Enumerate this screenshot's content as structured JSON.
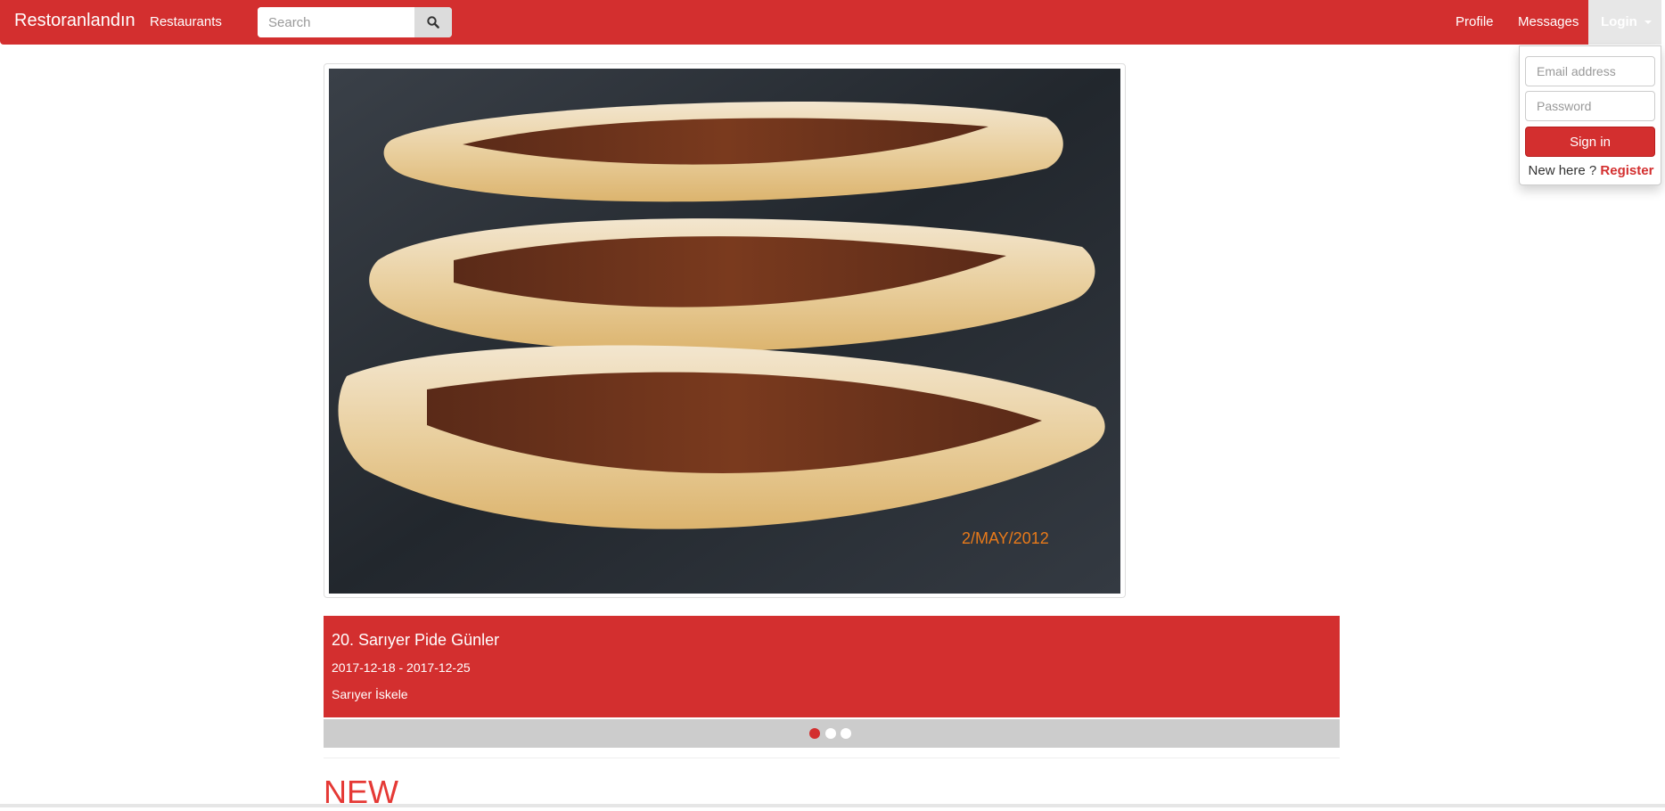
{
  "navbar": {
    "brand": "Restoranlandın",
    "restaurants_label": "Restaurants",
    "search_placeholder": "Search",
    "profile_label": "Profile",
    "messages_label": "Messages",
    "login_label": "Login"
  },
  "login_dropdown": {
    "email_placeholder": "Email address",
    "password_placeholder": "Password",
    "signin_label": "Sign in",
    "new_here_text": "New here ?",
    "register_label": "Register"
  },
  "carousel": {
    "image_watermark": "2/MAY/2012",
    "title": "20. Sarıyer Pide Günler",
    "dates": "2017-12-18 - 2017-12-25",
    "location": "Sarıyer İskele",
    "indicator_count": 3,
    "active_index": 0
  },
  "section": {
    "heading": "NEW"
  },
  "colors": {
    "primary": "#d32f2f",
    "heading_red": "#e53935",
    "indicator_bar": "#cccccc"
  }
}
